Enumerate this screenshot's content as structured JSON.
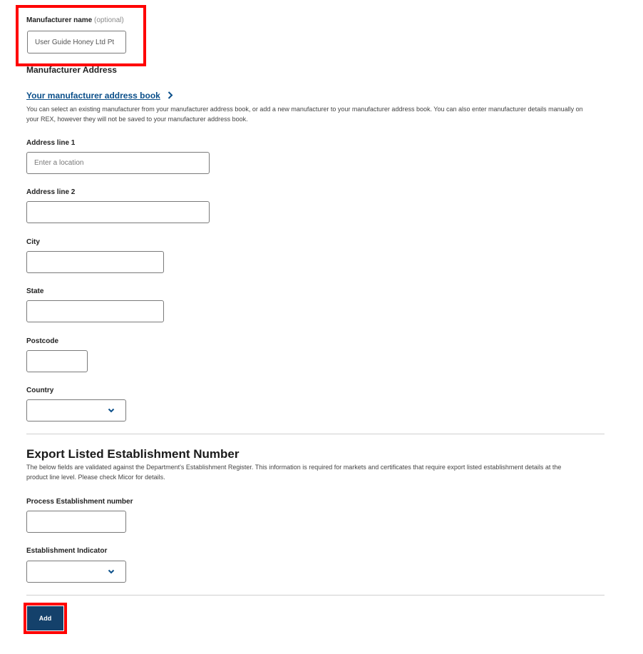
{
  "manufacturer": {
    "name_label": "Manufacturer name",
    "name_optional": "(optional)",
    "name_value": "User Guide Honey Ltd Pt"
  },
  "address": {
    "heading": "Manufacturer Address",
    "book_link": "Your manufacturer address book",
    "book_chevron": "›",
    "description": "You can select an existing manufacturer from your manufacturer address book, or add a new manufacturer to your manufacturer address book. You can also enter manufacturer details manually on your REX, however they will not be saved to your manufacturer address book.",
    "line1_label": "Address line 1",
    "line1_placeholder": "Enter a location",
    "line2_label": "Address line 2",
    "city_label": "City",
    "state_label": "State",
    "postcode_label": "Postcode",
    "country_label": "Country",
    "country_value": ""
  },
  "establishment": {
    "heading": "Export Listed Establishment Number",
    "description": "The below fields are validated against the Department's Establishment Register. This information is required for markets and certificates that require export listed establishment details at the product line level. Please check Micor for details.",
    "process_label": "Process Establishment number",
    "indicator_label": "Establishment Indicator",
    "indicator_value": ""
  },
  "actions": {
    "add_label": "Add"
  },
  "colors": {
    "highlight": "#ff0000",
    "link": "#0b4f8a",
    "button": "#14416b"
  }
}
